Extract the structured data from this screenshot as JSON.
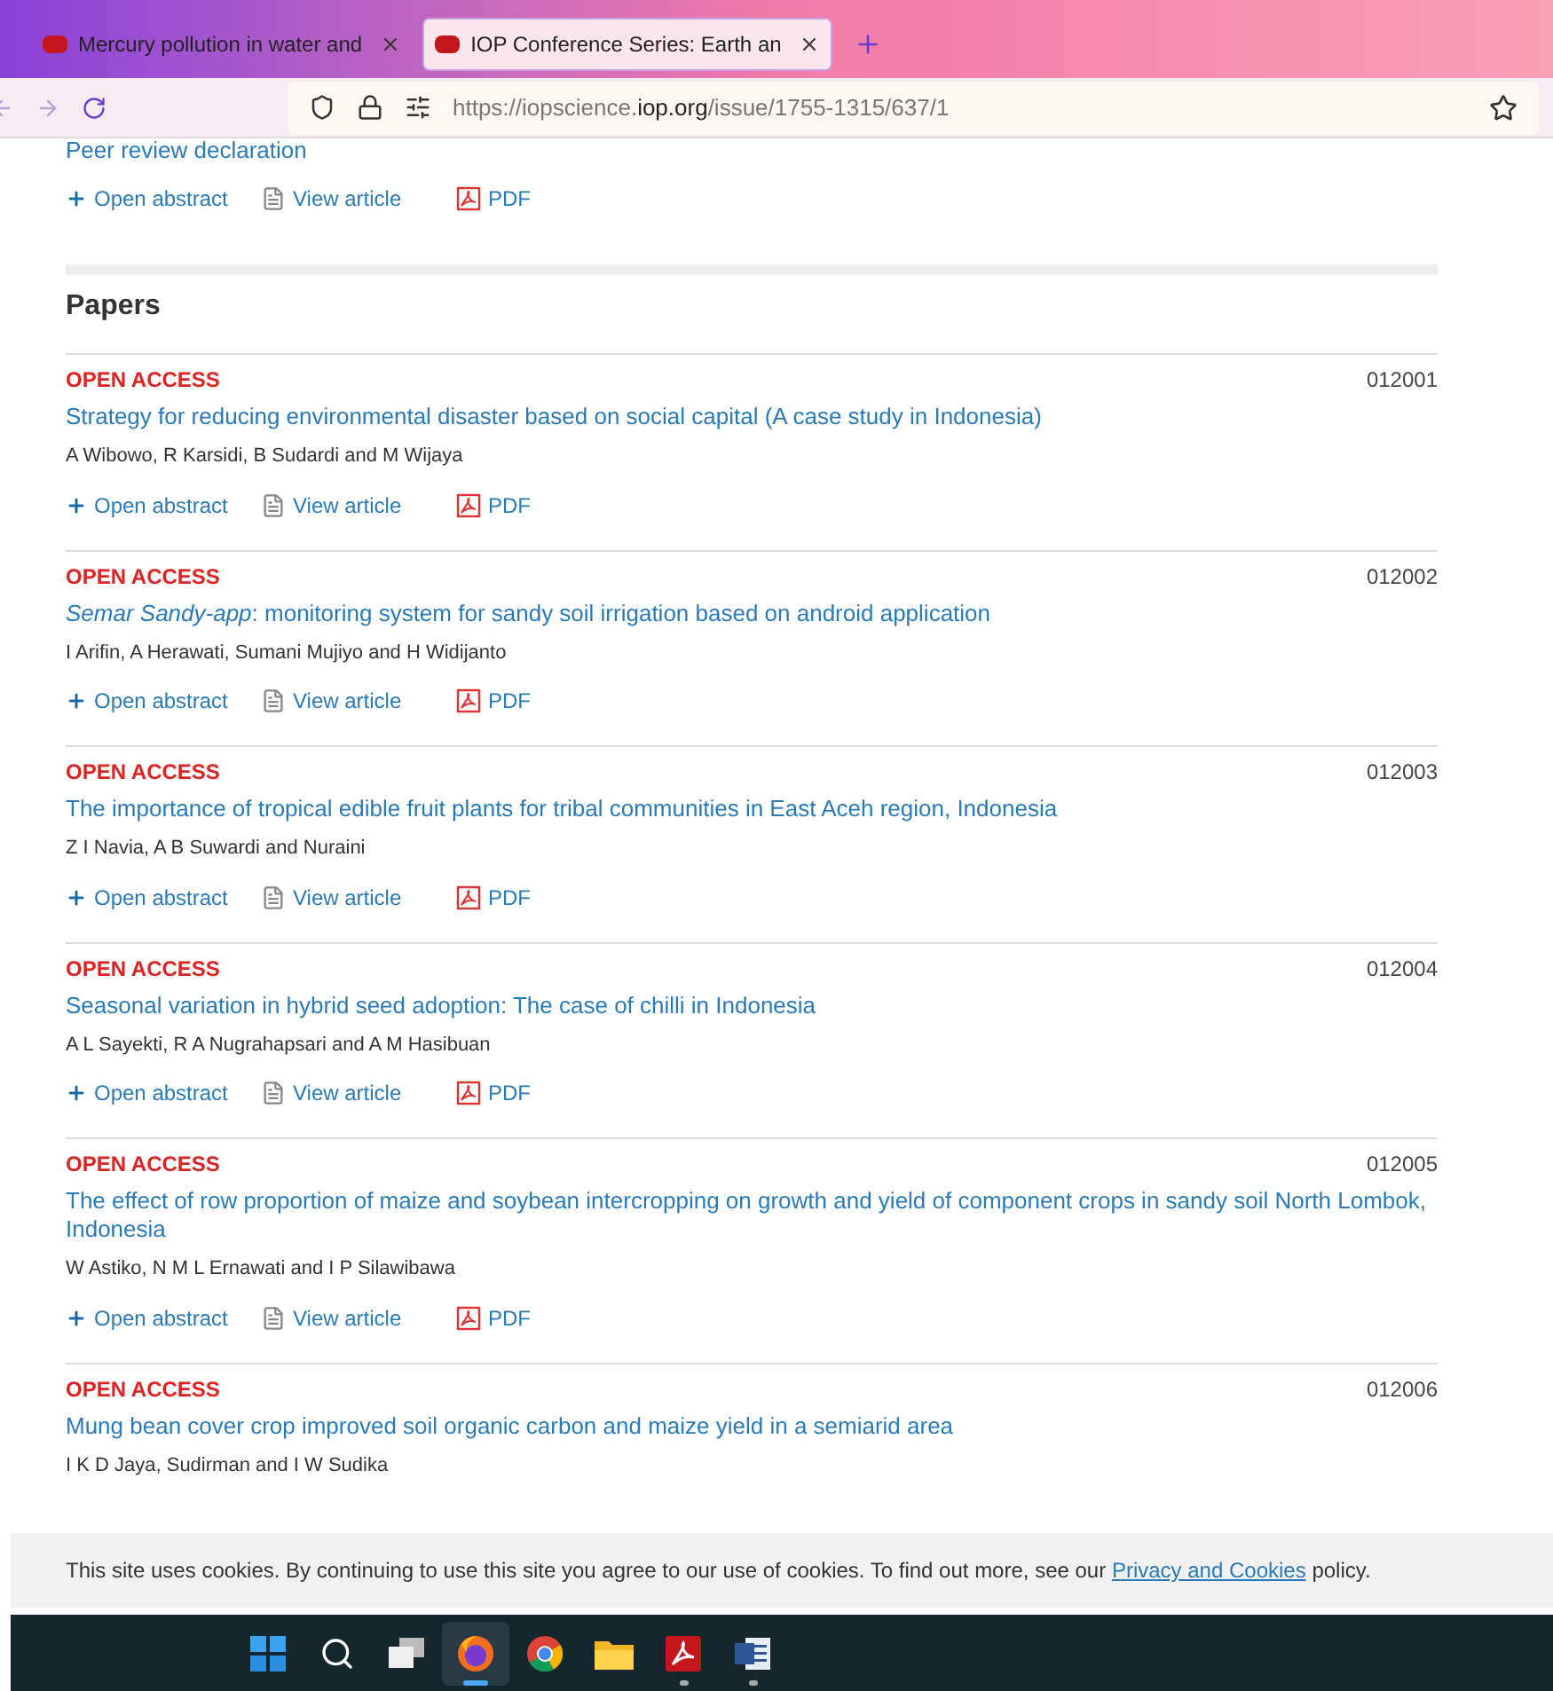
{
  "tabs": [
    {
      "title": "Mercury pollution in water and",
      "selected": false
    },
    {
      "title": "IOP Conference Series: Earth an",
      "selected": true
    }
  ],
  "address_bar": {
    "url_prefix": "https://iopscience.",
    "url_domain": "iop.org",
    "url_path": "/issue/1755-1315/637/1"
  },
  "top_item": {
    "title": "Peer review declaration",
    "actions": [
      {
        "kind": "abstract",
        "label": "Open abstract"
      },
      {
        "kind": "article",
        "label": "View article"
      },
      {
        "kind": "pdf",
        "label": "PDF"
      }
    ]
  },
  "section_heading": "Papers",
  "papers": [
    {
      "access": "OPEN ACCESS",
      "number": "012001",
      "title": "Strategy for reducing environmental disaster based on social capital (A case study in Indonesia)",
      "authors": "A Wibowo, R Karsidi, B Sudardi and M Wijaya",
      "actions": [
        {
          "kind": "abstract",
          "label": "Open abstract"
        },
        {
          "kind": "article",
          "label": "View article"
        },
        {
          "kind": "pdf",
          "label": "PDF"
        }
      ]
    },
    {
      "access": "OPEN ACCESS",
      "number": "012002",
      "title": "*Semar Sandy-app*: monitoring system for sandy soil irrigation based on android application",
      "authors": "I Arifin, A Herawati, Sumani Mujiyo and H Widijanto",
      "actions": [
        {
          "kind": "abstract",
          "label": "Open abstract"
        },
        {
          "kind": "article",
          "label": "View article"
        },
        {
          "kind": "pdf",
          "label": "PDF"
        }
      ]
    },
    {
      "access": "OPEN ACCESS",
      "number": "012003",
      "title": "The importance of tropical edible fruit plants for tribal communities in East Aceh region, Indonesia",
      "authors": "Z I Navia, A B Suwardi and Nuraini",
      "actions": [
        {
          "kind": "abstract",
          "label": "Open abstract"
        },
        {
          "kind": "article",
          "label": "View article"
        },
        {
          "kind": "pdf",
          "label": "PDF"
        }
      ]
    },
    {
      "access": "OPEN ACCESS",
      "number": "012004",
      "title": "Seasonal variation in hybrid seed adoption: The case of chilli in Indonesia",
      "authors": "A L Sayekti, R A Nugrahapsari and A M Hasibuan",
      "actions": [
        {
          "kind": "abstract",
          "label": "Open abstract"
        },
        {
          "kind": "article",
          "label": "View article"
        },
        {
          "kind": "pdf",
          "label": "PDF"
        }
      ]
    },
    {
      "access": "OPEN ACCESS",
      "number": "012005",
      "title": "The effect of row proportion of maize and soybean intercropping on growth and yield of component crops in sandy soil North Lombok, Indonesia",
      "authors": "W Astiko, N M L Ernawati and I P Silawibawa",
      "actions": [
        {
          "kind": "abstract",
          "label": "Open abstract"
        },
        {
          "kind": "article",
          "label": "View article"
        },
        {
          "kind": "pdf",
          "label": "PDF"
        }
      ]
    },
    {
      "access": "OPEN ACCESS",
      "number": "012006",
      "title": "Mung bean cover crop improved soil organic carbon and maize yield in a semiarid area",
      "authors": "I K D Jaya, Sudirman and I W Sudika"
    }
  ],
  "cookie_notice": {
    "text": "This site uses cookies. By continuing to use this site you agree to our use of cookies. To find out more, see our",
    "link": "Privacy and Cookies",
    "suffix": "policy."
  },
  "taskbar": {
    "apps": [
      {
        "kind": "start",
        "selected": false,
        "running": false
      },
      {
        "kind": "search",
        "selected": false,
        "running": false
      },
      {
        "kind": "taskview",
        "selected": false,
        "running": false
      },
      {
        "kind": "firefox",
        "selected": true,
        "running": true
      },
      {
        "kind": "chrome",
        "selected": false,
        "running": false
      },
      {
        "kind": "folder",
        "selected": false,
        "running": false
      },
      {
        "kind": "pdf",
        "selected": false,
        "running": true
      },
      {
        "kind": "word",
        "selected": false,
        "running": true
      }
    ]
  }
}
